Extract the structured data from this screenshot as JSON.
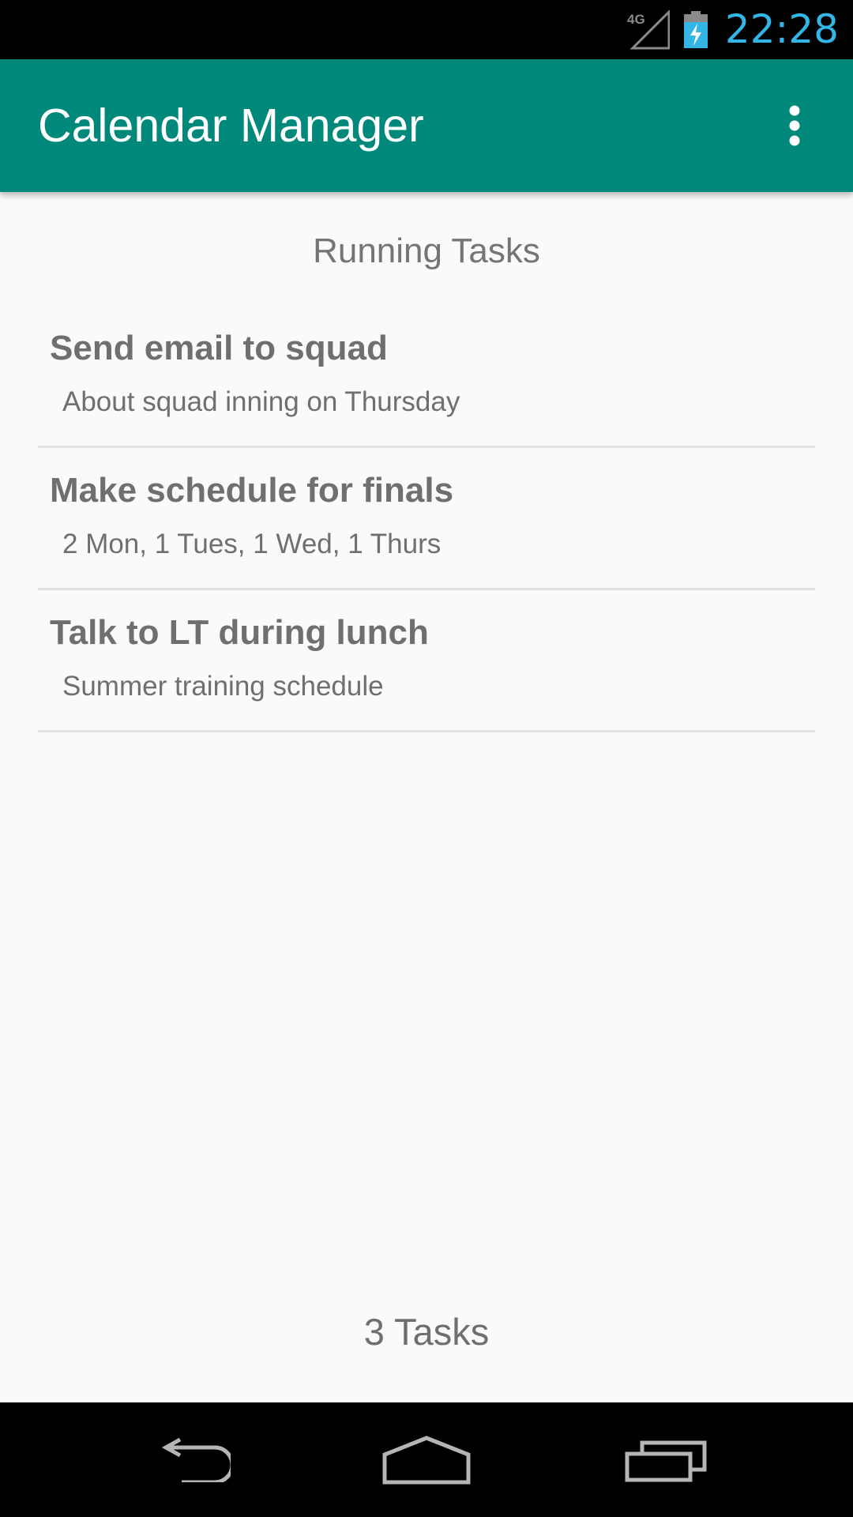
{
  "status_bar": {
    "network_icon": "signal-4g-icon",
    "network_label": "4G",
    "battery_icon": "battery-charging-icon",
    "time": "22:28",
    "time_color": "#33b5e5"
  },
  "app_bar": {
    "title": "Calendar Manager",
    "color": "#00897b",
    "overflow_icon": "more-vert-icon"
  },
  "main": {
    "section_title": "Running Tasks",
    "tasks": [
      {
        "title": "Send email to squad",
        "description": "About squad inning on Thursday"
      },
      {
        "title": "Make schedule for finals",
        "description": "2 Mon, 1 Tues, 1 Wed, 1 Thurs"
      },
      {
        "title": "Talk to LT during lunch",
        "description": "Summer training schedule"
      }
    ],
    "task_count": "3 Tasks"
  },
  "nav_bar": {
    "back_icon": "back-icon",
    "home_icon": "home-icon",
    "recents_icon": "recents-icon"
  }
}
